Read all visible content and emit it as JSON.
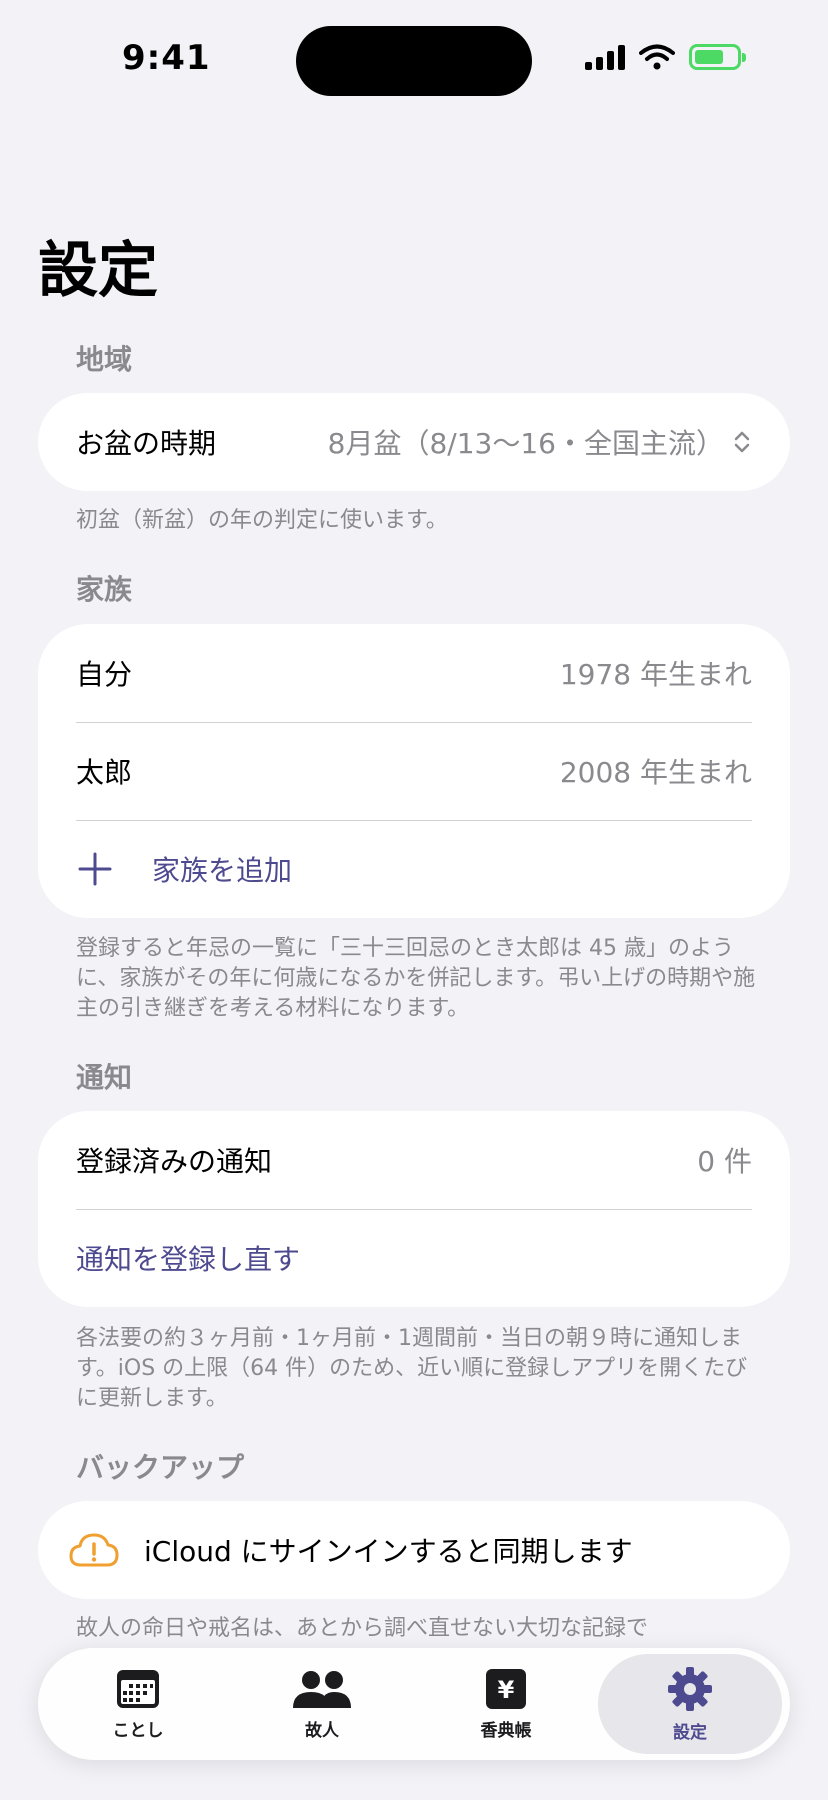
{
  "status_bar": {
    "time": "9:41"
  },
  "page": {
    "title": "設定"
  },
  "region": {
    "header": "地域",
    "obon_label": "お盆の時期",
    "obon_value": "8月盆（8/13〜16・全国主流）",
    "footnote": "初盆（新盆）の年の判定に使います。"
  },
  "family": {
    "header": "家族",
    "members": [
      {
        "name": "自分",
        "birth": "1978 年生まれ"
      },
      {
        "name": "太郎",
        "birth": "2008 年生まれ"
      }
    ],
    "add_label": "家族を追加",
    "footnote": "登録すると年忌の一覧に「三十三回忌のとき太郎は 45 歳」のように、家族がその年に何歳になるかを併記します。弔い上げの時期や施主の引き継ぎを考える材料になります。"
  },
  "notifications": {
    "header": "通知",
    "registered_label": "登録済みの通知",
    "registered_count": "0 件",
    "reregister_label": "通知を登録し直す",
    "footnote": "各法要の約３ヶ月前・1ヶ月前・1週間前・当日の朝９時に通知します。iOS の上限（64 件）のため、近い順に登録しアプリを開くたびに更新します。"
  },
  "backup": {
    "header": "バックアップ",
    "icloud_label": "iCloud にサインインすると同期します",
    "footnote": "故人の命日や戒名は、あとから調べ直せない大切な記録で"
  },
  "tabbar": {
    "tabs": [
      {
        "label": "ことし",
        "icon": "calendar-icon"
      },
      {
        "label": "故人",
        "icon": "people-icon"
      },
      {
        "label": "香典帳",
        "icon": "yen-icon"
      },
      {
        "label": "設定",
        "icon": "gear-icon"
      }
    ],
    "active_index": 3
  },
  "colors": {
    "accent": "#4e4a8f",
    "warning": "#f0a030",
    "background": "#f2f2f7",
    "battery": "#4cd964"
  }
}
